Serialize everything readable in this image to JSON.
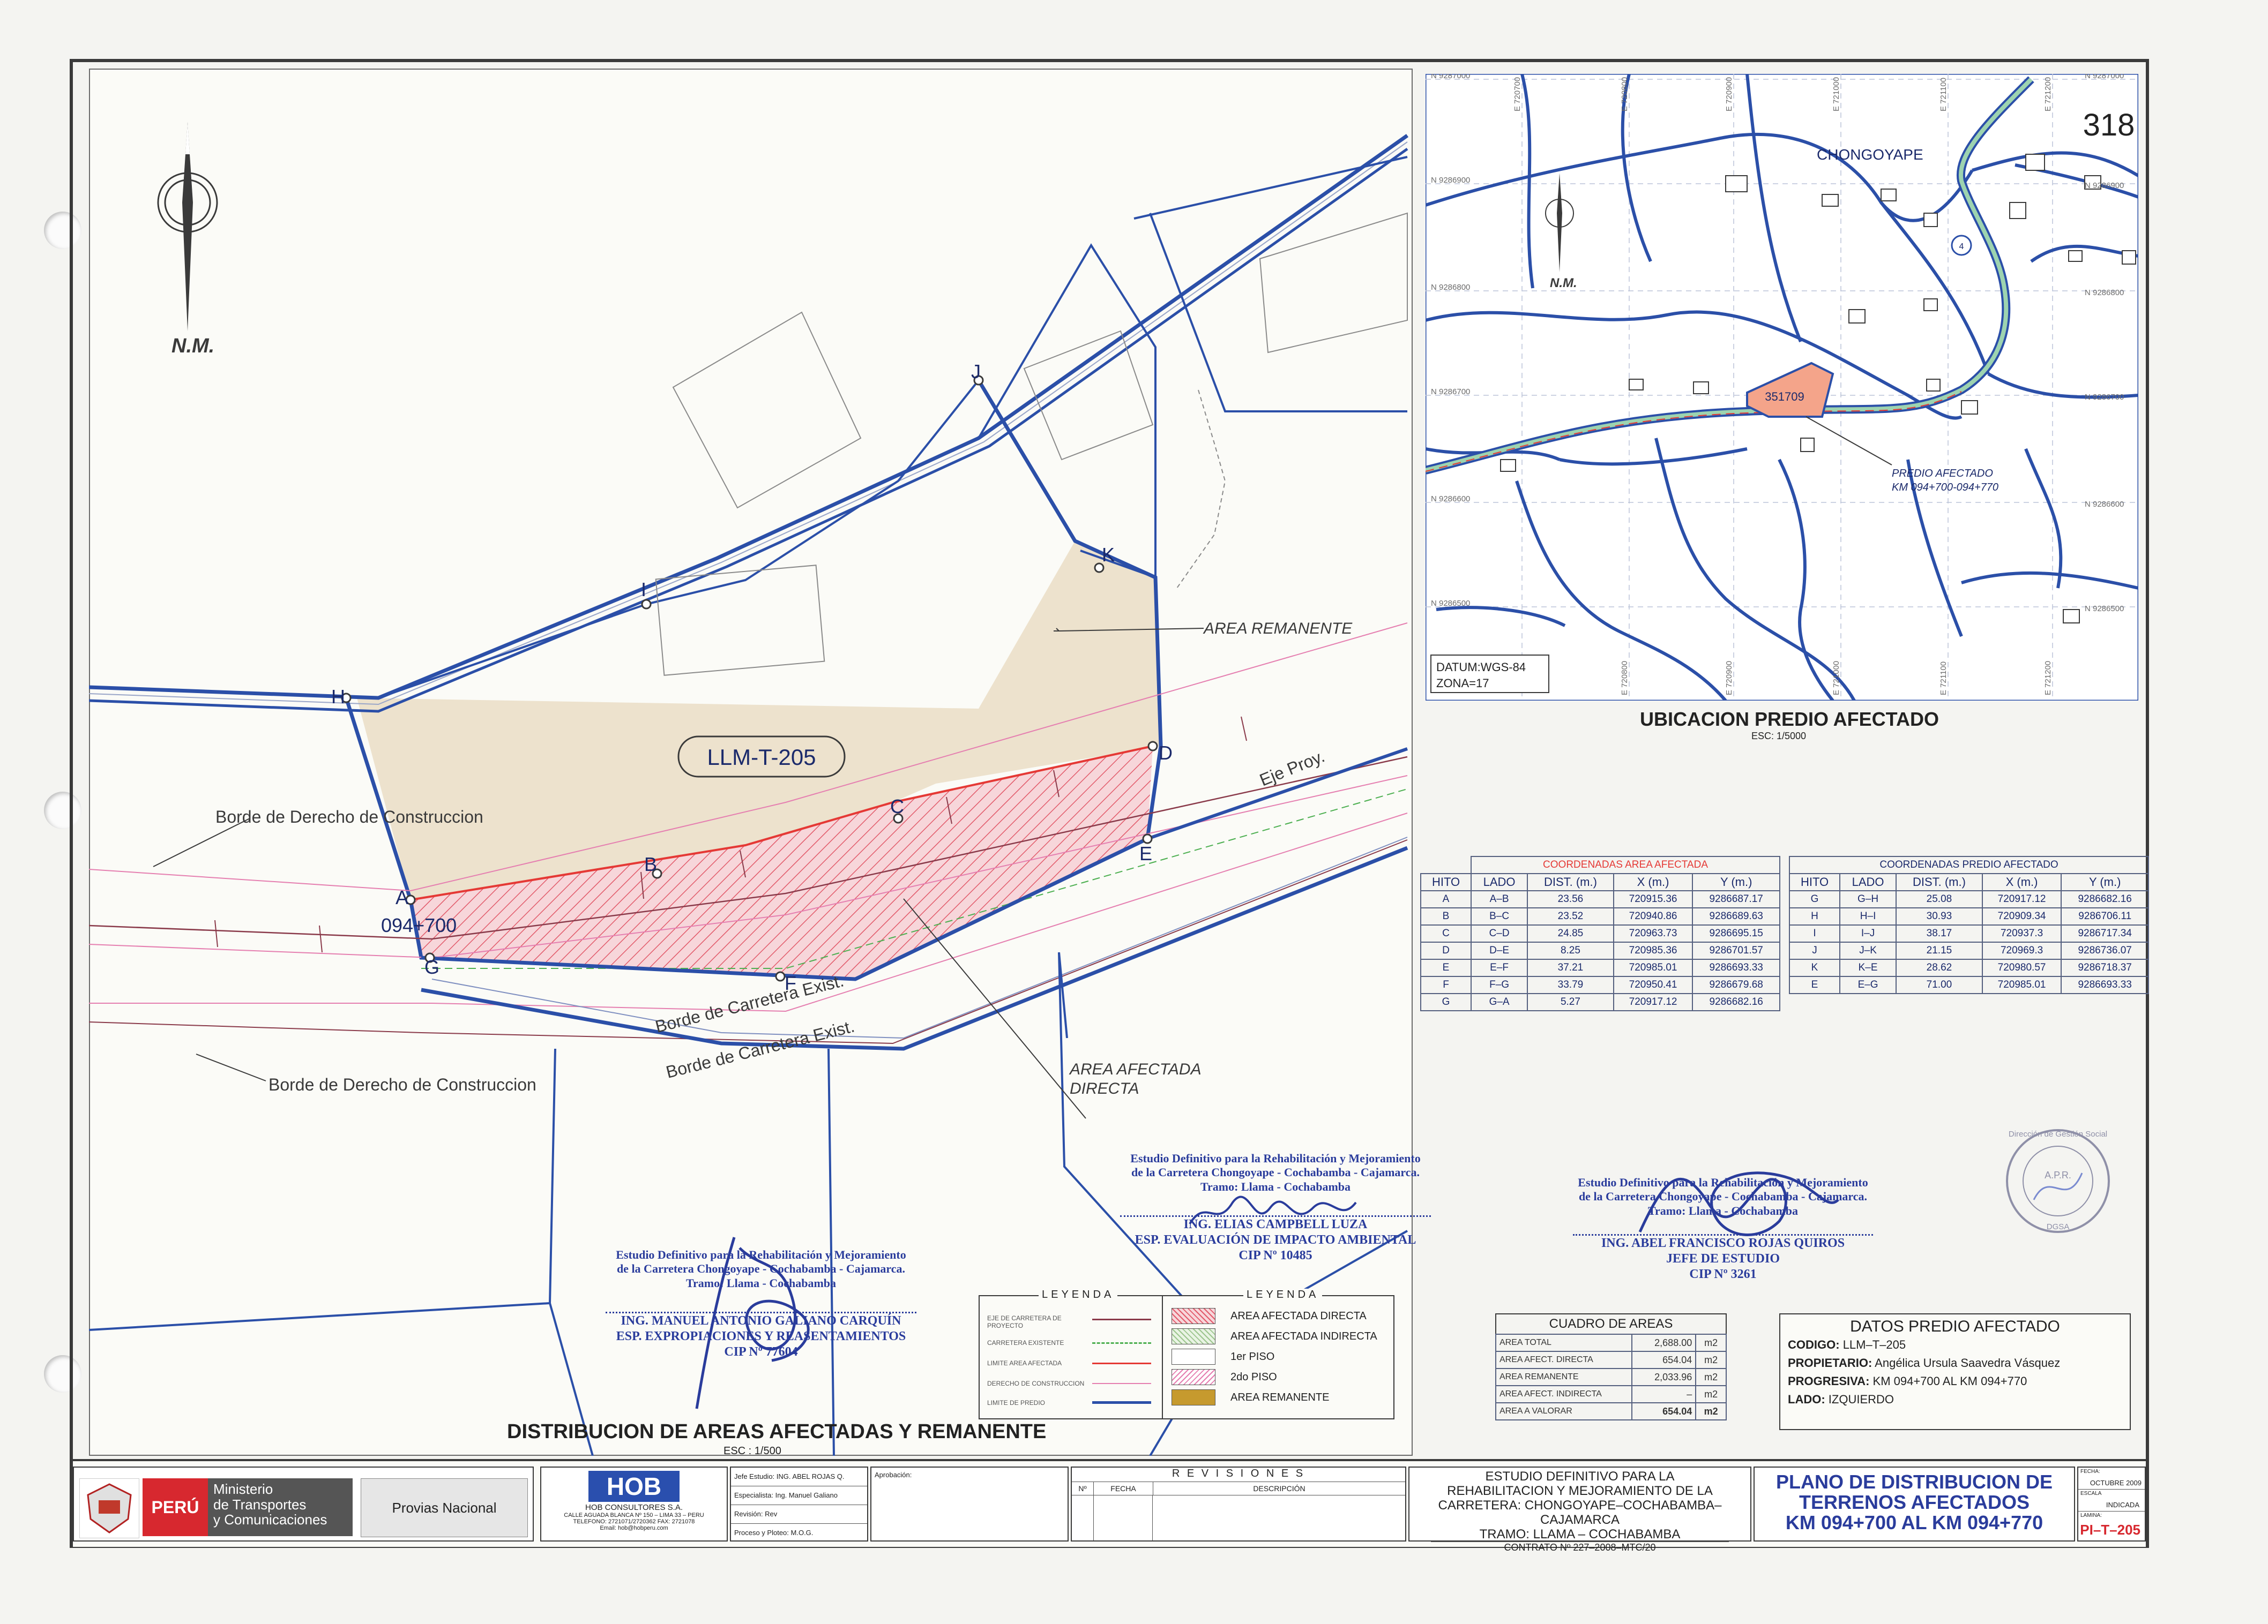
{
  "sheet_number": "318",
  "north_label": "N.M.",
  "main_map": {
    "parcel_code": "LLM-T-205",
    "progressive": "094+700",
    "labels": {
      "area_remanente": "AREA REMANENTE",
      "area_afectada_directa_1": "AREA AFECTADA",
      "area_afectada_directa_2": "DIRECTA",
      "borde_derecho_1": "Borde de Derecho de Construccion",
      "borde_derecho_2": "Borde de Derecho de Construccion",
      "borde_carretera_1": "Borde de Carretera Exist.",
      "borde_carretera_2": "Borde de Carretera Exist.",
      "eje_proy": "Eje Proy."
    },
    "points": [
      "A",
      "B",
      "C",
      "D",
      "E",
      "F",
      "G",
      "H",
      "I",
      "J",
      "K"
    ],
    "title": "DISTRIBUCION DE AREAS AFECTADAS Y REMANENTE",
    "scale": "ESC : 1/500"
  },
  "location_map": {
    "town": "CHONGOYAPE",
    "parcel_id": "351709",
    "predio_label_1": "PREDIO AFECTADO",
    "predio_label_2": "KM 094+700-094+770",
    "datum_1": "DATUM:WGS-84",
    "datum_2": "ZONA=17",
    "north_labels": [
      "N 9287000",
      "N 9286900",
      "N 9286800",
      "N 9286700",
      "N 9286600",
      "N 9286500"
    ],
    "east_labels": [
      "E 720700",
      "E 720800",
      "E 720900",
      "E 721000",
      "E 721100",
      "E 721200"
    ],
    "title": "UBICACION PREDIO AFECTADO",
    "scale": "ESC: 1/5000"
  },
  "coord_afectada": {
    "title": "COORDENADAS AREA AFECTADA",
    "headers": [
      "HITO",
      "LADO",
      "DIST. (m.)",
      "X (m.)",
      "Y (m.)"
    ],
    "rows": [
      [
        "A",
        "A–B",
        "23.56",
        "720915.36",
        "9286687.17"
      ],
      [
        "B",
        "B–C",
        "23.52",
        "720940.86",
        "9286689.63"
      ],
      [
        "C",
        "C–D",
        "24.85",
        "720963.73",
        "9286695.15"
      ],
      [
        "D",
        "D–E",
        "8.25",
        "720985.36",
        "9286701.57"
      ],
      [
        "E",
        "E–F",
        "37.21",
        "720985.01",
        "9286693.33"
      ],
      [
        "F",
        "F–G",
        "33.79",
        "720950.41",
        "9286679.68"
      ],
      [
        "G",
        "G–A",
        "5.27",
        "720917.12",
        "9286682.16"
      ]
    ]
  },
  "coord_predio": {
    "title": "COORDENADAS PREDIO AFECTADO",
    "headers": [
      "HITO",
      "LADO",
      "DIST. (m.)",
      "X (m.)",
      "Y (m.)"
    ],
    "rows": [
      [
        "G",
        "G–H",
        "25.08",
        "720917.12",
        "9286682.16"
      ],
      [
        "H",
        "H–I",
        "30.93",
        "720909.34",
        "9286706.11"
      ],
      [
        "I",
        "I–J",
        "38.17",
        "720937.3",
        "9286717.34"
      ],
      [
        "J",
        "J–K",
        "21.15",
        "720969.3",
        "9286736.07"
      ],
      [
        "K",
        "K–E",
        "28.62",
        "720980.57",
        "9286718.37"
      ],
      [
        "E",
        "E–G",
        "71.00",
        "720985.01",
        "9286693.33"
      ]
    ]
  },
  "cuadro_areas": {
    "title": "CUADRO DE AREAS",
    "rows": [
      [
        "AREA TOTAL",
        "2,688.00",
        "m2"
      ],
      [
        "AREA AFECT. DIRECTA",
        "654.04",
        "m2"
      ],
      [
        "AREA REMANENTE",
        "2,033.96",
        "m2"
      ],
      [
        "AREA AFECT. INDIRECTA",
        "–",
        "m2"
      ],
      [
        "AREA A VALORAR",
        "654.04",
        "m2"
      ]
    ]
  },
  "datos_predio": {
    "title": "DATOS PREDIO AFECTADO",
    "rows": [
      [
        "CODIGO:",
        "LLM–T–205"
      ],
      [
        "PROPIETARIO:",
        "Angélica Ursula Saavedra Vásquez"
      ],
      [
        "PROGRESIVA:",
        "KM 094+700 AL KM 094+770"
      ],
      [
        "LADO:",
        "IZQUIERDO"
      ]
    ]
  },
  "leyenda_lines": {
    "title": "LEYENDA",
    "items": [
      {
        "label": "EJE DE CARRETERA DE PROYECTO",
        "color": "#8a3a4a"
      },
      {
        "label": "CARRETERA EXISTENTE",
        "color": "#4caf50"
      },
      {
        "label": "LIMITE AREA AFECTADA",
        "color": "#e53935"
      },
      {
        "label": "DERECHO DE CONSTRUCCION",
        "color": "#e57fb0"
      },
      {
        "label": "LIMITE DE PREDIO",
        "color": "#2b4fa8"
      }
    ]
  },
  "leyenda_areas": {
    "title": "LEYENDA",
    "items": [
      {
        "label": "AREA AFECTADA DIRECTA",
        "color": "#f3b8c0"
      },
      {
        "label": "AREA AFECTADA INDIRECTA",
        "color": "#cfe6c7"
      },
      {
        "label": "1er PISO",
        "color": "#ffffff"
      },
      {
        "label": "2do PISO",
        "color": "#ffffff"
      },
      {
        "label": "AREA REMANENTE",
        "color": "#c69a2e"
      }
    ]
  },
  "stamps": {
    "center_1": "Estudio Definitivo para la Rehabilitación y Mejoramiento",
    "center_2": "de la Carretera Chongoyape - Cochabamba - Cajamarca.",
    "center_3": "Tramo: Llama - Cochabamba",
    "center_name": "ING. ELIAS CAMPBELL LUZA",
    "center_role": "ESP. EVALUACIÓN DE IMPACTO AMBIENTAL",
    "center_cip": "CIP Nº 10485",
    "left_1": "Estudio Definitivo para la Rehabilitación y Mejoramiento",
    "left_2": "de la Carretera Chongoyape - Cochabamba - Cajamarca.",
    "left_3": "Tramo: Llama - Cochabamba",
    "left_name": "ING. MANUEL ANTONIO GALIANO CARQUÍN",
    "left_role": "ESP. EXPROPIACIONES Y REASENTAMIENTOS",
    "left_cip": "CIP Nº 77604",
    "right_1": "Estudio Definitivo para la Rehabilitación y Mejoramiento",
    "right_2": "de la Carretera Chongoyape - Cochabamba - Cajamarca.",
    "right_3": "Tramo: Llama - Cochabamba",
    "right_name": "ING. ABEL FRANCISCO ROJAS QUIROS",
    "right_role": "JEFE DE ESTUDIO",
    "right_cip": "CIP Nº 3261"
  },
  "title_block": {
    "peru": "PERÚ",
    "ministerio_1": "Ministerio",
    "ministerio_2": "de Transportes",
    "ministerio_3": "y Comunicaciones",
    "provias": "Provias Nacional",
    "hob": "HOB",
    "hob_name": "HOB CONSULTORES S.A.",
    "hob_addr_1": "CALLE AGUADA BLANCA Nº 150 – LIMA 33 – PERU",
    "hob_addr_2": "TELEFONO: 2721071/2720362  FAX: 2721078",
    "hob_addr_3": "Email: hob@hobperu.com",
    "staff": [
      [
        "Jefe Estudio:",
        "ING. ABEL ROJAS Q."
      ],
      [
        "Especialista:",
        "Ing. Manuel Galiano"
      ],
      [
        "Revisión:",
        "Rev"
      ],
      [
        "Proceso y Ploteo:",
        "M.O.G."
      ]
    ],
    "aprobacion": "Aprobación:",
    "revisiones": "R E V I S I O N E S",
    "rev_headers": [
      "Nº",
      "FECHA",
      "DESCRIPCIÓN"
    ],
    "study_1": "ESTUDIO DEFINITIVO PARA LA",
    "study_2": "REHABILITACION Y MEJORAMIENTO DE LA",
    "study_3": "CARRETERA: CHONGOYAPE–COCHABAMBA–CAJAMARCA",
    "study_4": "TRAMO: LLAMA – COCHABAMBA",
    "contrato": "CONTRATO Nº 227–2008–MTC/20",
    "plan_1": "PLANO DE DISTRIBUCION DE",
    "plan_2": "TERRENOS AFECTADOS",
    "plan_3": "KM 094+700 AL KM 094+770",
    "fecha_label": "FECHA:",
    "fecha": "OCTUBRE 2009",
    "escala_label": "ESCALA",
    "escala": "INDICADA",
    "lamina_label": "LAMINA:",
    "lamina": "PI–T–205"
  },
  "seal": {
    "line_1": "Dirección de Gestión Social",
    "line_2": "A.P.R.",
    "line_3": "DGSA"
  }
}
